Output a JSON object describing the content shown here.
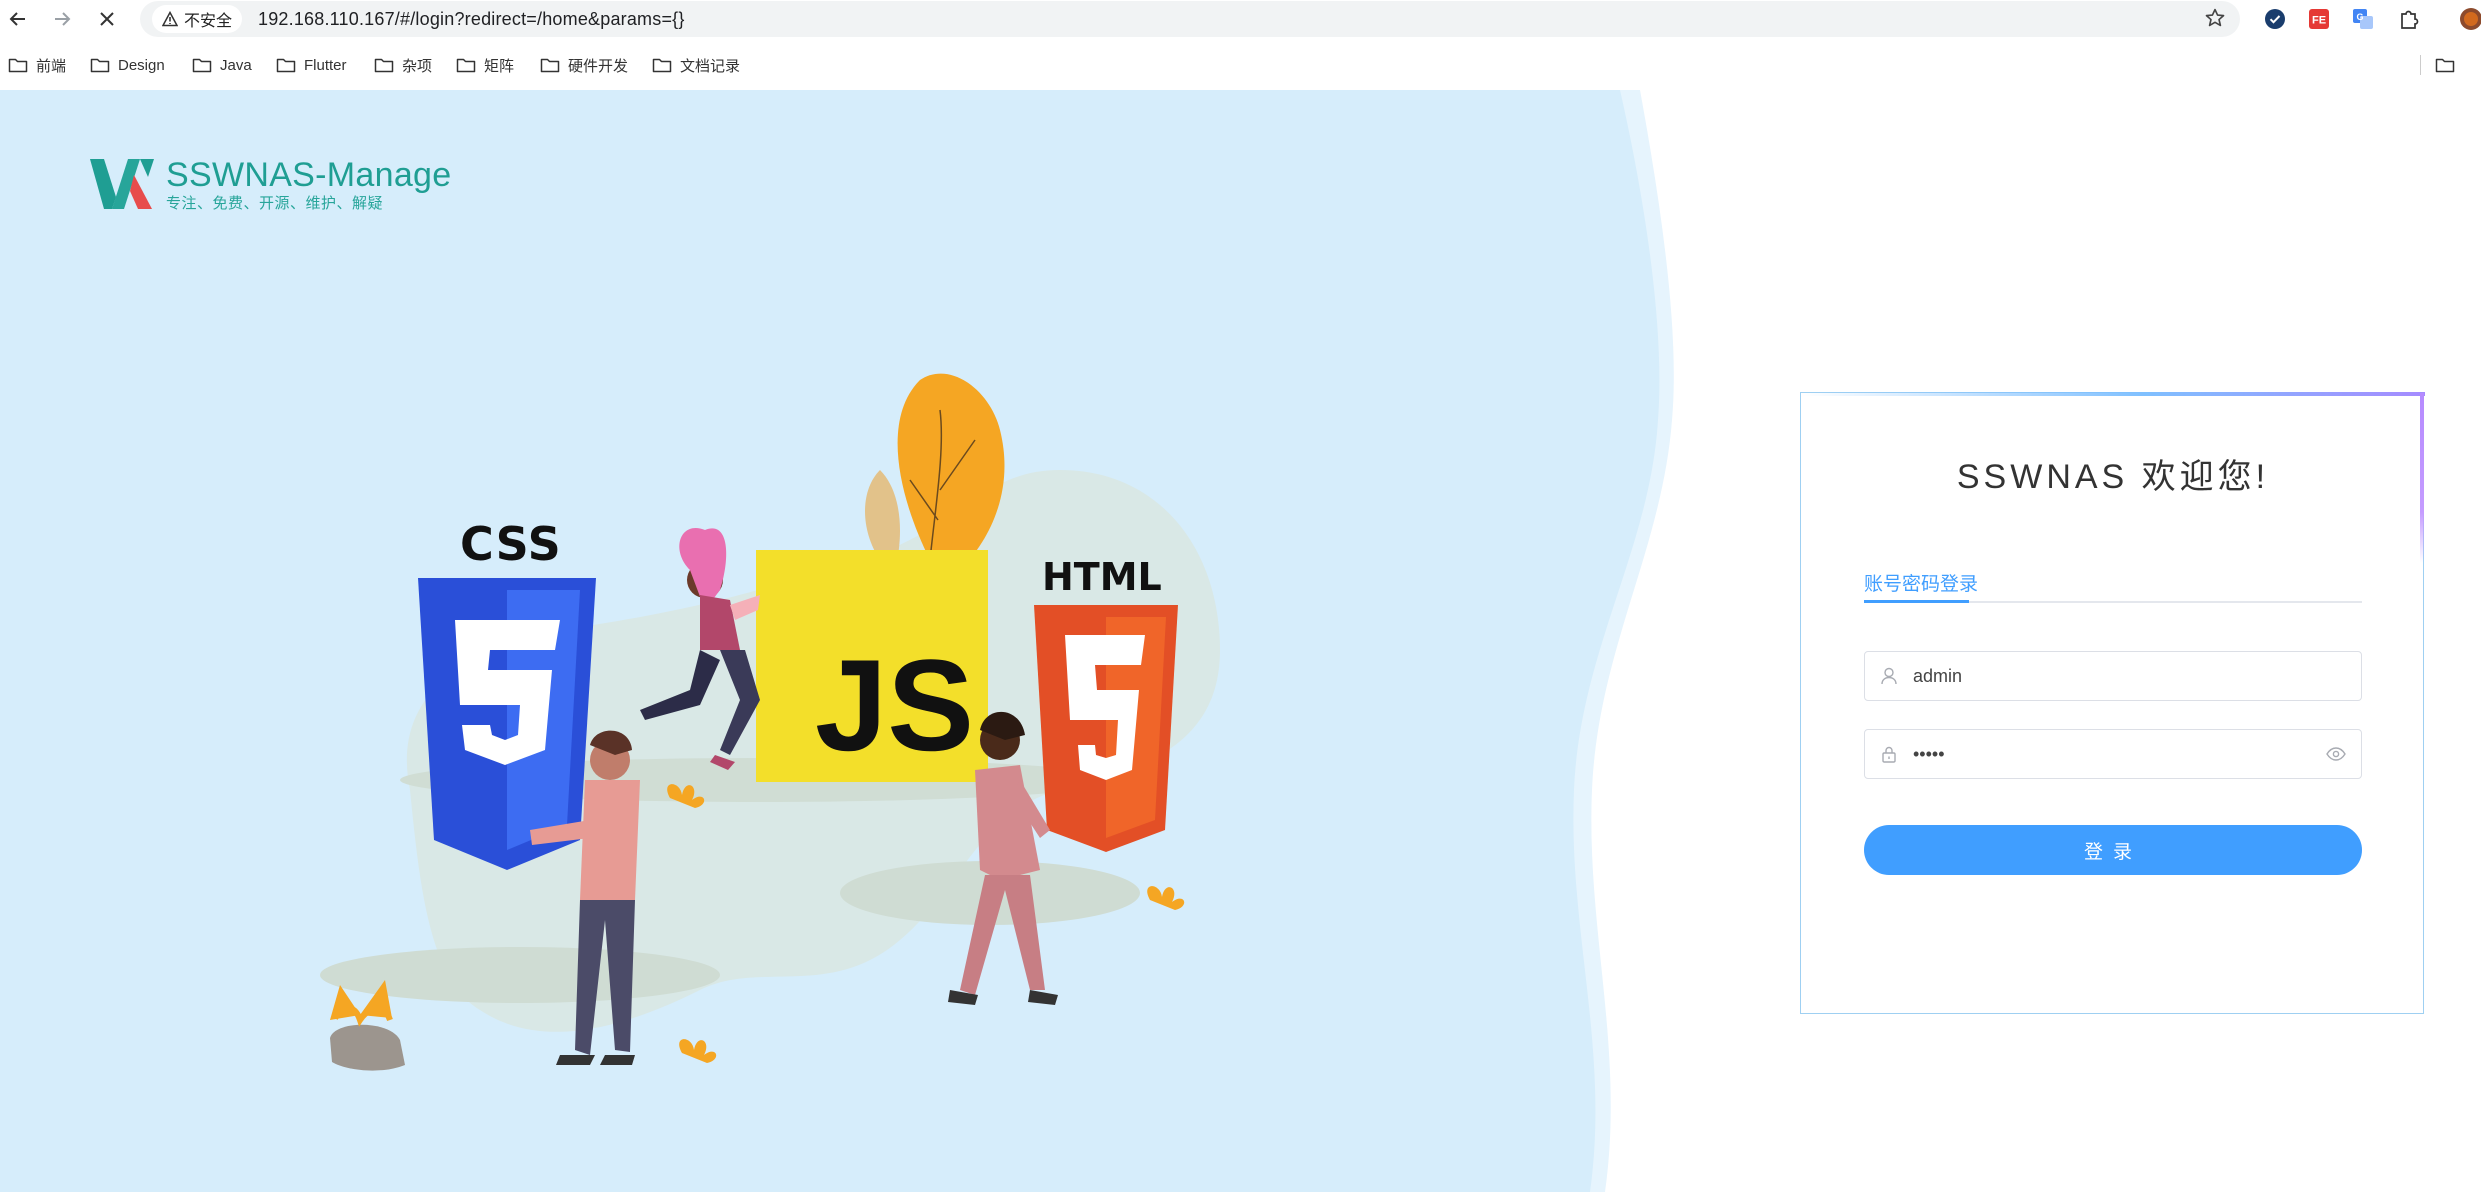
{
  "browser": {
    "security_label": "不安全",
    "url": "192.168.110.167/#/login?redirect=/home&params={}",
    "bookmarks": [
      "前端",
      "Design",
      "Java",
      "Flutter",
      "杂项",
      "矩阵",
      "硬件开发",
      "文档记录"
    ],
    "extension_icons": [
      "shield-check-icon",
      "fe-helper-icon",
      "translate-icon",
      "puzzle-icon",
      "profile-avatar-icon"
    ]
  },
  "logo": {
    "title": "SSWNAS-Manage",
    "subtitle": "专注、免费、开源、维护、解疑"
  },
  "illustration": {
    "badges": [
      "CSS",
      "JS",
      "HTML"
    ]
  },
  "login": {
    "title": "SSWNAS 欢迎您!",
    "tab_label": "账号密码登录",
    "username_value": "admin",
    "password_value": "•••••",
    "button_label": "登录"
  },
  "colors": {
    "accent": "#409eff",
    "brand": "#1f9e93",
    "background": "#d6edfb"
  }
}
